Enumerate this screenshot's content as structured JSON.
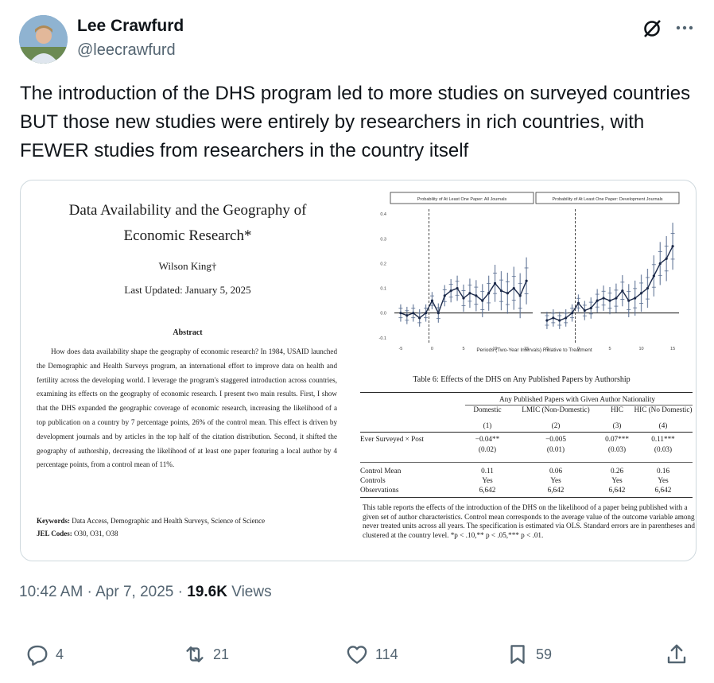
{
  "author": {
    "name": "Lee Crawfurd",
    "handle": "@leecrawfurd"
  },
  "icons": {
    "grok": "grok-icon",
    "more": "more-icon",
    "reply": "reply-icon",
    "retweet": "retweet-icon",
    "like": "heart-icon",
    "bookmark": "bookmark-icon",
    "share": "share-icon"
  },
  "tweet_text": "The introduction of the DHS program led to more studies on surveyed countries BUT those new studies were entirely by researchers in rich countries, with FEWER studies from researchers in the country itself",
  "paper": {
    "title_line1": "Data Availability and the Geography of",
    "title_line2": "Economic Research*",
    "author": "Wilson King†",
    "date": "Last Updated: January 5, 2025",
    "abstract_heading": "Abstract",
    "abstract": "How does data availability shape the geography of economic research? In 1984, USAID launched the Demographic and Health Surveys program, an international effort to improve data on health and fertility across the developing world. I leverage the program's staggered introduction across countries, examining its effects on the geography of economic research. I present two main results. First, I show that the DHS expanded the geographic coverage of economic research, increasing the likelihood of a top publication on a country by 7 percentage points, 26% of the control mean. This effect is driven by development journals and by articles in the top half of the citation distribution. Second, it shifted the geography of authorship, decreasing the likelihood of at least one paper featuring a local author by 4 percentage points, from a control mean of 11%.",
    "keywords_label": "Keywords:",
    "keywords": "Data Access, Demographic and Health Surveys, Science of Science",
    "jel_label": "JEL Codes:",
    "jel": "O30, O31, O38"
  },
  "figure": {
    "panel_left_title": "Probability of At Least One Paper: All Journals",
    "panel_right_title": "Probability of At Least One Paper: Development Journals",
    "y_ticks": [
      "0.4",
      "0.3",
      "0.2",
      "0.1",
      "0.0",
      "-0.1"
    ],
    "x_ticks": [
      "-5",
      "0",
      "5",
      "10",
      "15"
    ],
    "x_label": "Periods (Two-Year Intervals) Relative to Treatment"
  },
  "chart_data": [
    {
      "type": "line",
      "title": "Probability of At Least One Paper: All Journals",
      "xlabel": "Periods (Two-Year Intervals) Relative to Treatment",
      "ylabel": "",
      "xlim": [
        -6,
        16
      ],
      "ylim": [
        -0.12,
        0.42
      ],
      "x": [
        -5,
        -4,
        -3,
        -2,
        -1,
        0,
        1,
        2,
        3,
        4,
        5,
        6,
        7,
        8,
        9,
        10,
        11,
        12,
        13,
        14,
        15
      ],
      "series": [
        {
          "values": [
            0.0,
            -0.01,
            0.0,
            -0.02,
            0.0,
            0.05,
            0.0,
            0.07,
            0.09,
            0.1,
            0.06,
            0.08,
            0.07,
            0.05,
            0.08,
            0.12,
            0.09,
            0.08,
            0.1,
            0.07,
            0.13
          ]
        }
      ]
    },
    {
      "type": "line",
      "title": "Probability of At Least One Paper: Development Journals",
      "xlabel": "Periods (Two-Year Intervals) Relative to Treatment",
      "ylabel": "",
      "xlim": [
        -6,
        16
      ],
      "ylim": [
        -0.12,
        0.42
      ],
      "x": [
        -5,
        -4,
        -3,
        -2,
        -1,
        0,
        1,
        2,
        3,
        4,
        5,
        6,
        7,
        8,
        9,
        10,
        11,
        12,
        13,
        14,
        15
      ],
      "series": [
        {
          "values": [
            -0.03,
            -0.02,
            -0.03,
            -0.02,
            0.0,
            0.04,
            0.01,
            0.02,
            0.05,
            0.06,
            0.05,
            0.06,
            0.09,
            0.05,
            0.06,
            0.08,
            0.1,
            0.15,
            0.2,
            0.22,
            0.27
          ]
        }
      ]
    }
  ],
  "table": {
    "caption": "Table 6: Effects of the DHS on Any Published Papers by Authorship",
    "group_header": "Any Published Papers with Given Author Nationality",
    "col_headers": [
      "Domestic",
      "LMIC (Non-Domestic)",
      "HIC",
      "HIC (No Domestic)"
    ],
    "col_numbers": [
      "(1)",
      "(2)",
      "(3)",
      "(4)"
    ],
    "row_label": "Ever Surveyed × Post",
    "coefs": [
      "−0.04**",
      "−0.005",
      "0.07***",
      "0.11***"
    ],
    "ses": [
      "(0.02)",
      "(0.01)",
      "(0.03)",
      "(0.03)"
    ],
    "stats_labels": [
      "Control Mean",
      "Controls",
      "Observations"
    ],
    "stats": [
      [
        "0.11",
        "0.06",
        "0.26",
        "0.16"
      ],
      [
        "Yes",
        "Yes",
        "Yes",
        "Yes"
      ],
      [
        "6,642",
        "6,642",
        "6,642",
        "6,642"
      ]
    ],
    "footnote": "This table reports the effects of the introduction of the DHS on the likelihood of a paper being published with a given set of author characteristics. Control mean corresponds to the average value of the outcome variable among never treated units across all years. The specification is estimated via OLS. Standard errors are in parentheses and clustered at the country level. *p < .10,** p < .05,*** p < .01."
  },
  "meta": {
    "time": "10:42 AM",
    "sep1": " · ",
    "date": "Apr 7, 2025",
    "sep2": " · ",
    "views": "19.6K",
    "views_label": " Views"
  },
  "actions": {
    "replies": "4",
    "reposts": "21",
    "likes": "114",
    "bookmarks": "59"
  }
}
